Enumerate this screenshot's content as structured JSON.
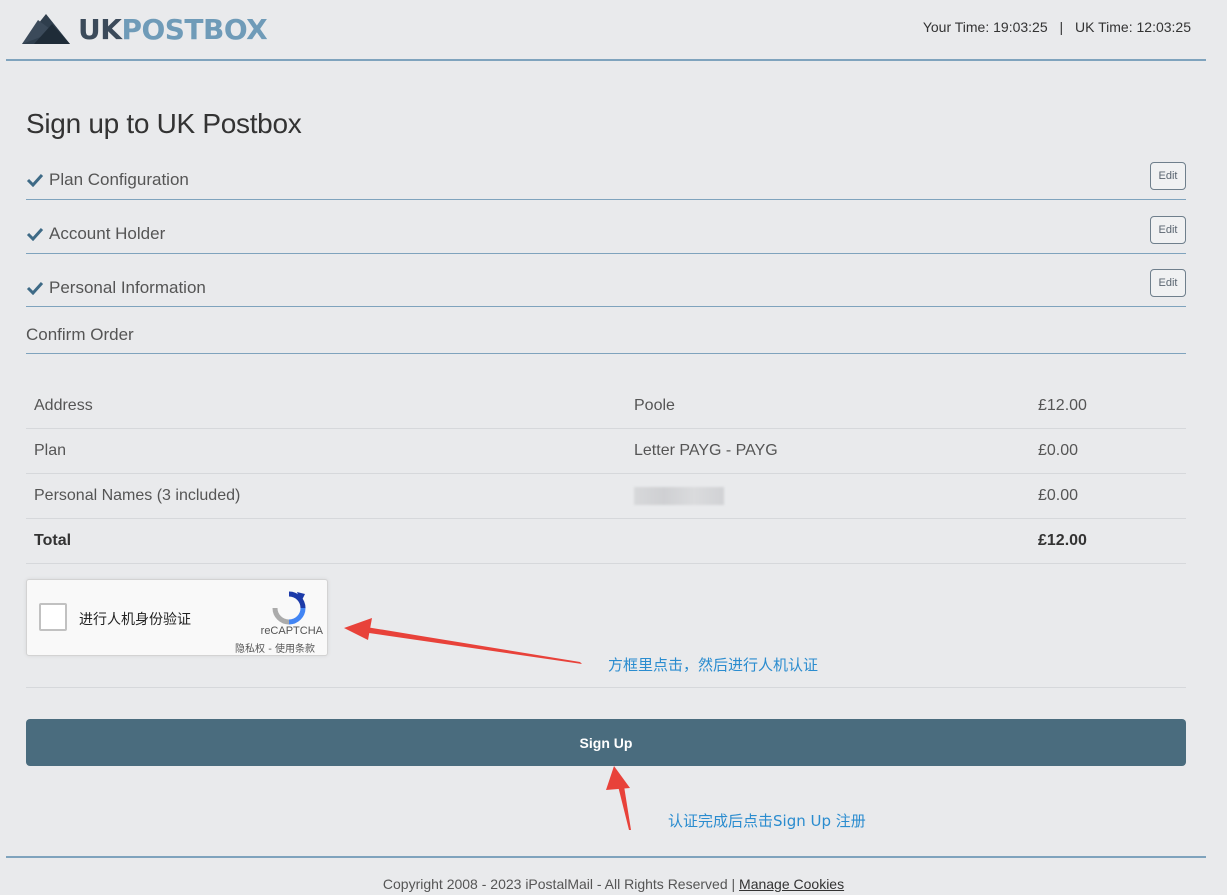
{
  "header": {
    "logo_uk": "UK",
    "logo_post": "POSTBOX",
    "your_time_label": "Your Time: 19:03:25",
    "separator": "|",
    "uk_time_label": "UK Time: 12:03:25"
  },
  "title": "Sign up to UK Postbox",
  "steps": [
    {
      "label": "Plan Configuration",
      "edit": "Edit"
    },
    {
      "label": "Account Holder",
      "edit": "Edit"
    },
    {
      "label": "Personal Information",
      "edit": "Edit"
    },
    {
      "label": "Confirm Order"
    }
  ],
  "order": {
    "rows": [
      {
        "item": "Address",
        "detail": "Poole",
        "price": "£12.00"
      },
      {
        "item": "Plan",
        "detail": "Letter PAYG - PAYG",
        "price": "£0.00"
      },
      {
        "item": "Personal Names (3 included)",
        "detail": "",
        "price": "£0.00"
      }
    ],
    "total_label": "Total",
    "total_price": "£12.00"
  },
  "captcha": {
    "label": "进行人机身份验证",
    "brand": "reCAPTCHA",
    "links": "隐私权 - 使用条款"
  },
  "annotations": {
    "captcha_note": "方框里点击，然后进行人机认证",
    "signup_note": "认证完成后点击Sign Up 注册"
  },
  "signup_button": "Sign Up",
  "footer": {
    "copyright": "Copyright 2008 - 2023 iPostalMail - All Rights Reserved |",
    "cookies": "Manage Cookies"
  },
  "colors": {
    "accent": "#7fa3bd",
    "button": "#4a6c7e",
    "annotation": "#2a8ccf",
    "arrow": "#e8423a"
  }
}
